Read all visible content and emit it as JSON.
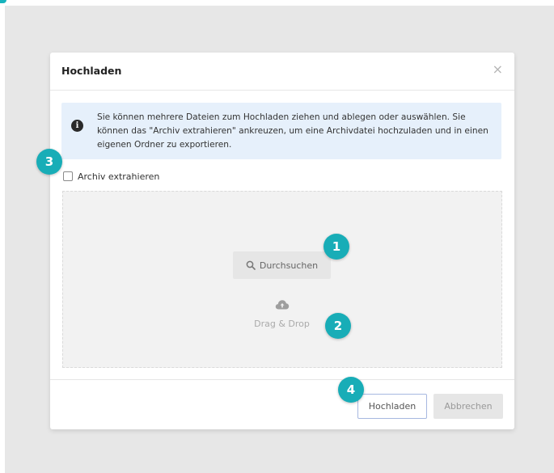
{
  "dialog": {
    "title": "Hochladen",
    "close_glyph": "×",
    "info_text": "Sie können mehrere Dateien zum Hochladen ziehen und ablegen oder auswählen. Sie können das \"Archiv extrahieren\" ankreuzen, um eine Archivdatei hochzuladen und in einen eigenen Ordner zu exportieren.",
    "info_icon": "info-circle-icon"
  },
  "checkbox": {
    "label": "Archiv extrahieren",
    "checked": false
  },
  "dropzone": {
    "browse_label": "Durchsuchen",
    "browse_icon": "search-icon",
    "drag_icon": "cloud-upload-icon",
    "drag_text": "Drag & Drop"
  },
  "footer": {
    "upload_label": "Hochladen",
    "cancel_label": "Abbrechen"
  },
  "badges": [
    "1",
    "2",
    "3",
    "4"
  ],
  "colors": {
    "badge": "#18adb7",
    "info_bg": "#e6f0fb",
    "upload_border": "#a7b8e0"
  }
}
